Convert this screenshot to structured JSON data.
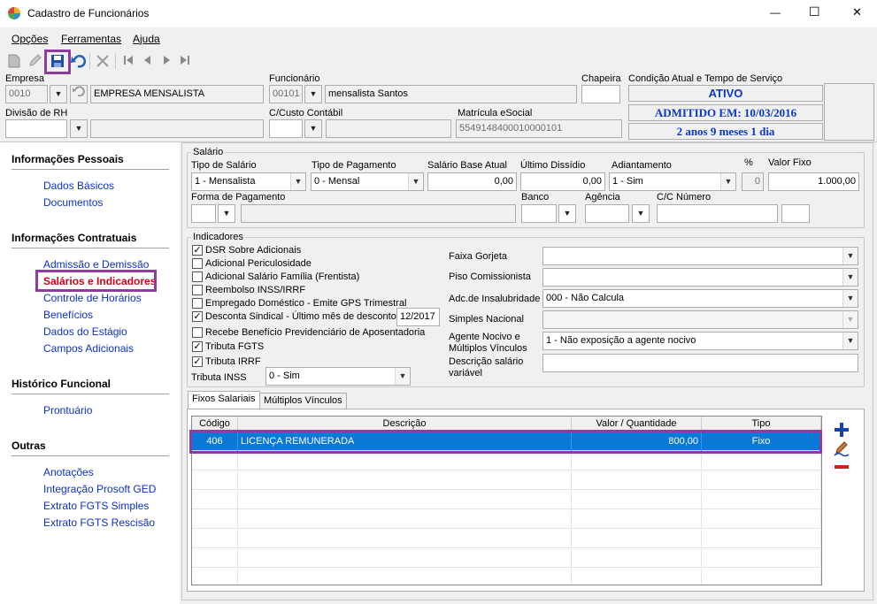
{
  "window": {
    "title": "Cadastro de Funcionários",
    "minimize": "—",
    "maximize": "☐",
    "close": "✕"
  },
  "menu": {
    "items": [
      "Opções",
      "Ferramentas",
      "Ajuda"
    ]
  },
  "toolbar": {
    "icons": [
      "new-icon",
      "edit-icon",
      "save-icon",
      "undo-icon",
      "delete-icon",
      "first-icon",
      "previous-icon",
      "next-icon",
      "last-icon"
    ]
  },
  "header": {
    "empresa_label": "Empresa",
    "empresa_code": "0010",
    "empresa_name": "EMPRESA MENSALISTA",
    "funcionario_label": "Funcionário",
    "funcionario_code": "00101",
    "funcionario_name": "mensalista Santos",
    "chapeira_label": "Chapeira",
    "chapeira_value": "",
    "condicao_label": "Condição Atual e Tempo de Serviço",
    "status_ativo": "ATIVO",
    "status_admitido": "ADMITIDO EM: 10/03/2016",
    "status_tempo": "2 anos 9 meses 1 dia",
    "divisao_label": "Divisão de RH",
    "divisao_value": "",
    "ccusto_label": "C/Custo Contábil",
    "ccusto_value": "",
    "matricula_label": "Matrícula eSocial",
    "matricula_value": "5549148400010000101"
  },
  "sidebar": {
    "sections": [
      {
        "title": "Informações Pessoais",
        "items": [
          "Dados Básicos",
          "Documentos"
        ]
      },
      {
        "title": "Informações Contratuais",
        "items": [
          "Admissão e Demissão",
          "Salários e Indicadores",
          "Controle de Horários",
          "Benefícios",
          "Dados do Estágio",
          "Campos Adicionais"
        ]
      },
      {
        "title": "Histórico Funcional",
        "items": [
          "Prontuário"
        ]
      },
      {
        "title": "Outras",
        "items": [
          "Anotações",
          "Integração Prosoft GED",
          "Extrato FGTS Simples",
          "Extrato FGTS Rescisão"
        ]
      }
    ],
    "active": "Salários e Indicadores"
  },
  "salario": {
    "group_title": "Salário",
    "tipo_label": "Tipo de Salário",
    "tipo_value": "1 - Mensalista",
    "tipo_pagamento_label": "Tipo de Pagamento",
    "tipo_pagamento_value": "0 - Mensal",
    "base_label": "Salário Base Atual",
    "base_value": "0,00",
    "dissidio_label": "Último Dissídio",
    "dissidio_value": "0,00",
    "adiantamento_label": "Adiantamento",
    "adiantamento_value": "1 - Sim",
    "pct_label": "%",
    "pct_value": "0",
    "valor_fixo_label": "Valor Fixo",
    "valor_fixo_value": "1.000,00",
    "forma_label": "Forma de Pagamento",
    "banco_label": "Banco",
    "agencia_label": "Agência",
    "cc_label": "C/C Número"
  },
  "indicadores": {
    "group_title": "Indicadores",
    "checks": [
      {
        "label": "DSR Sobre Adicionais",
        "checked": true
      },
      {
        "label": "Adicional Periculosidade",
        "checked": false
      },
      {
        "label": "Adicional Salário Família (Frentista)",
        "checked": false
      },
      {
        "label": "Reembolso INSS/IRRF",
        "checked": false
      },
      {
        "label": "Empregado Doméstico - Emite GPS Trimestral",
        "checked": false
      },
      {
        "label": "Desconta Sindical - Último mês de desconto",
        "checked": true
      },
      {
        "label": "Recebe Benefício Previdenciário de Aposentadoria",
        "checked": false
      },
      {
        "label": "Tributa FGTS",
        "checked": true
      },
      {
        "label": "Tributa IRRF",
        "checked": true
      }
    ],
    "sindical_date": "12/2017",
    "tributa_inss_label": "Tributa INSS",
    "tributa_inss_value": "0 - Sim",
    "faixa_gorjeta_label": "Faixa Gorjeta",
    "piso_label": "Piso Comissionista",
    "insalubridade_label": "Adc.de Insalubridade",
    "insalubridade_value": "000 - Não Calcula",
    "simples_label": "Simples Nacional",
    "agente_label_1": "Agente Nocivo e",
    "agente_label_2": "Múltiplos Vínculos",
    "agente_value": "1 - Não exposição a agente nocivo",
    "descricao_label_1": "Descrição salário",
    "descricao_label_2": "variável"
  },
  "tabs": [
    "Fixos Salariais",
    "Múltiplos Vínculos"
  ],
  "grid": {
    "columns": [
      "Código",
      "Descrição",
      "Valor / Quantidade",
      "Tipo"
    ],
    "rows": [
      {
        "codigo": "406",
        "descricao": "LICENÇA REMUNERADA",
        "valor": "800,00",
        "tipo": "Fixo"
      }
    ]
  },
  "colors": {
    "link": "#0b30c8",
    "active_link": "#d3001c",
    "status": "#0a38c8",
    "highlight": "#8e3c9e",
    "selection": "#0a78d7"
  }
}
